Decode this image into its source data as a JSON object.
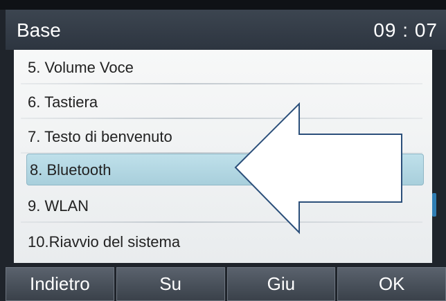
{
  "titlebar": {
    "title": "Base",
    "clock": "09 : 07"
  },
  "menu": {
    "items": [
      {
        "label": "5. Volume Voce",
        "selected": false
      },
      {
        "label": "6. Tastiera",
        "selected": false
      },
      {
        "label": "7. Testo di benvenuto",
        "selected": false
      },
      {
        "label": "8. Bluetooth",
        "selected": true
      },
      {
        "label": "9. WLAN",
        "selected": false
      },
      {
        "label": "10.Riavvio del sistema",
        "selected": false
      }
    ]
  },
  "softkeys": [
    {
      "label": "Indietro"
    },
    {
      "label": "Su"
    },
    {
      "label": "Giu"
    },
    {
      "label": "OK"
    }
  ],
  "colors": {
    "titlebar": "#2d3540",
    "selection": "#b3d7e3",
    "scroll_thumb": "#2f7db3",
    "softkey": "#4a525c"
  },
  "icons": {
    "overlay": "left-arrow-icon"
  }
}
